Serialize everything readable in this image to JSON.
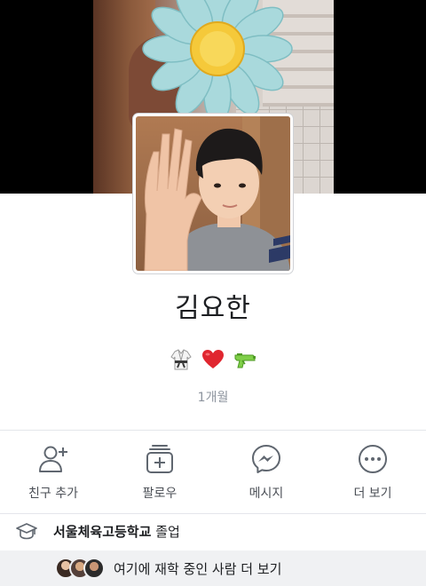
{
  "profile": {
    "name": "김요한",
    "joined": "1개월",
    "emoji_icons": [
      "karate-uniform-icon",
      "red-heart-icon",
      "water-pistol-icon"
    ]
  },
  "actions": [
    {
      "label": "친구 추가",
      "icon": "add-friend-icon"
    },
    {
      "label": "팔로우",
      "icon": "follow-icon"
    },
    {
      "label": "메시지",
      "icon": "messenger-icon"
    },
    {
      "label": "더 보기",
      "icon": "more-icon"
    }
  ],
  "education": {
    "school": "서울체육고등학교",
    "status": "졸업"
  },
  "more_people": {
    "label": "여기에 재학 중인 사람 더 보기"
  },
  "colors": {
    "icon": "#606770",
    "divider": "#e4e6eb",
    "subtext": "#8d949e"
  }
}
